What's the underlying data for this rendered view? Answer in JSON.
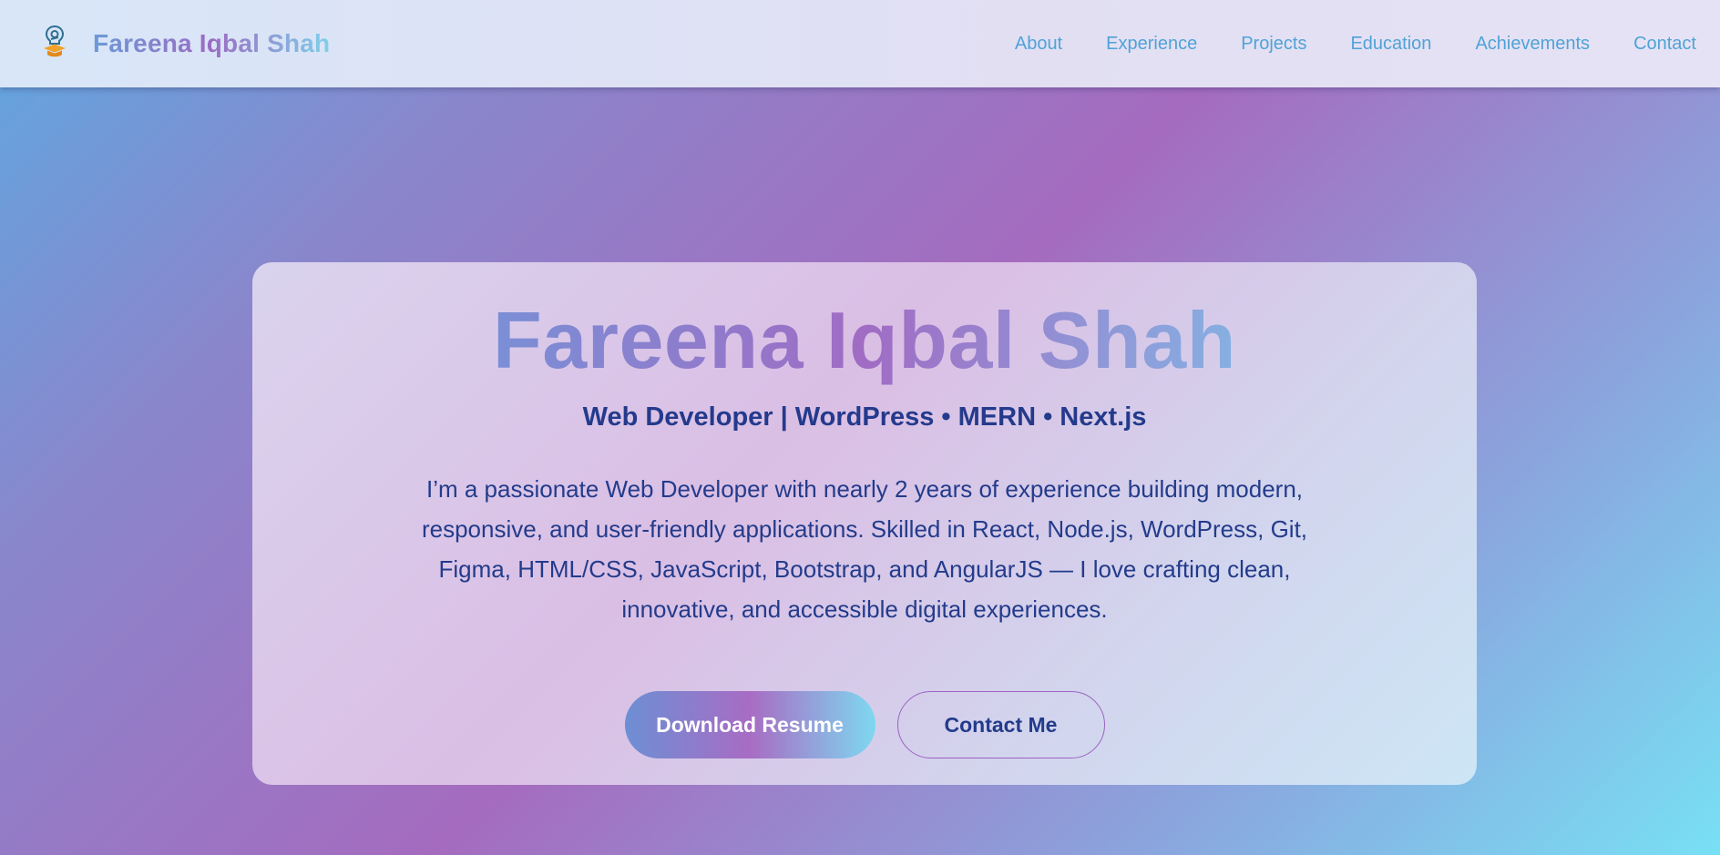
{
  "nav": {
    "brand": "Fareena Iqbal Shah",
    "logo_icon": "lightbulb-graduation-icon",
    "links": [
      "About",
      "Experience",
      "Projects",
      "Education",
      "Achievements",
      "Contact"
    ]
  },
  "hero": {
    "title": "Fareena Iqbal Shah",
    "subtitle": "Web Developer | WordPress • MERN • Next.js",
    "description": "I’m a passionate Web Developer with nearly 2 years of experience building modern, responsive, and user-friendly applications. Skilled in React, Node.js, WordPress, Git, Figma, HTML/CSS, JavaScript, Bootstrap, and AngularJS — I love crafting clean, innovative, and accessible digital experiences.",
    "primary_button": "Download Resume",
    "secondary_button": "Contact Me"
  },
  "colors": {
    "nav_link": "#4fa3d6",
    "heading_text": "#243a8c",
    "accent_purple": "#a56bbf",
    "accent_cyan": "#78e0f4"
  }
}
